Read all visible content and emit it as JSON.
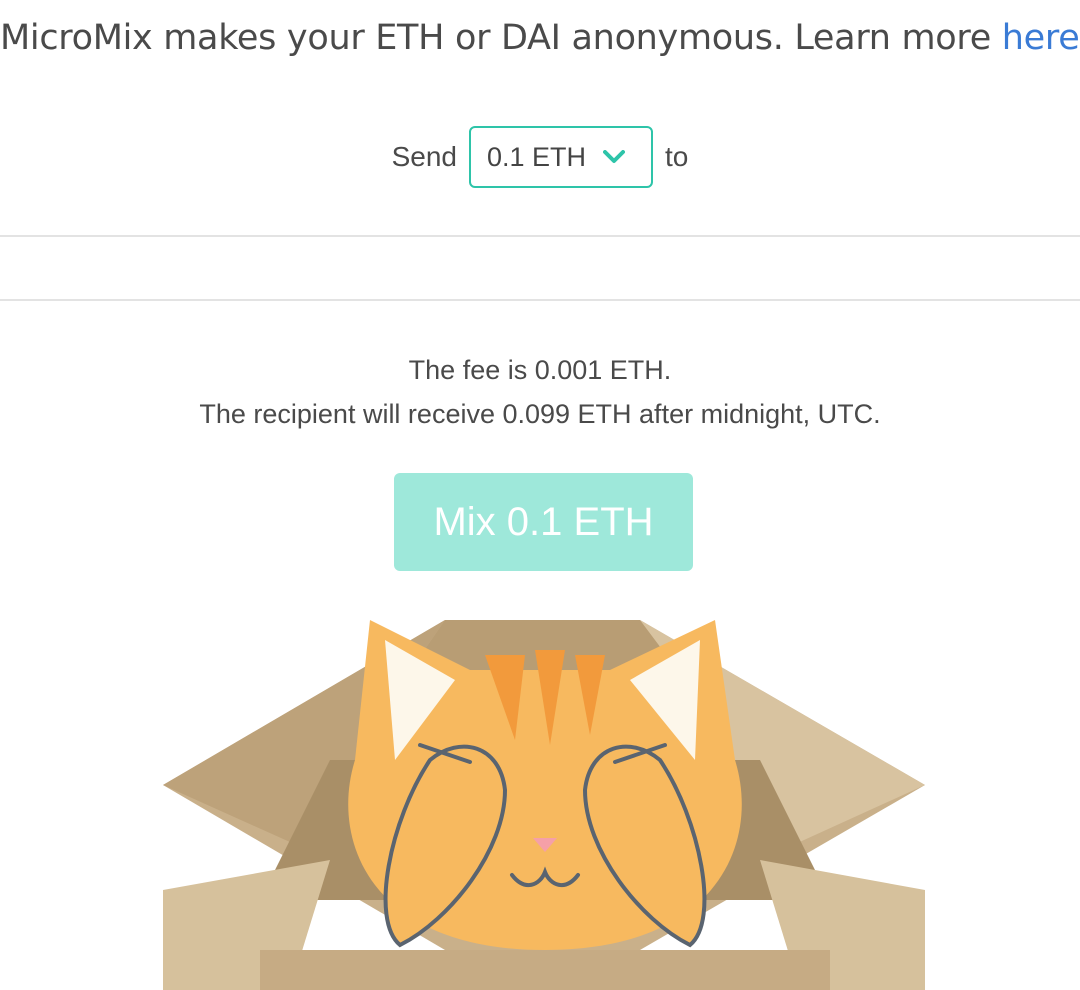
{
  "intro": {
    "text": "MicroMix makes your ETH or DAI anonymous. Learn more ",
    "link_label": "here",
    "period": "."
  },
  "send": {
    "prefix": "Send",
    "selected_amount": "0.1 ETH",
    "suffix": "to"
  },
  "recipient_input": {
    "value": "",
    "placeholder": ""
  },
  "fee": {
    "line1": "The fee is 0.001 ETH.",
    "line2": "The recipient will receive 0.099 ETH after midnight, UTC."
  },
  "mix_button": {
    "label": "Mix 0.1 ETH",
    "state": "disabled"
  },
  "colors": {
    "accent": "#2ec4a9",
    "button_disabled": "#9ee8da",
    "link": "#3a7bd5",
    "cat_orange": "#f7b95f",
    "box_tan": "#c6ab84"
  },
  "illustration": {
    "icon": "cat-in-box-illustration"
  }
}
